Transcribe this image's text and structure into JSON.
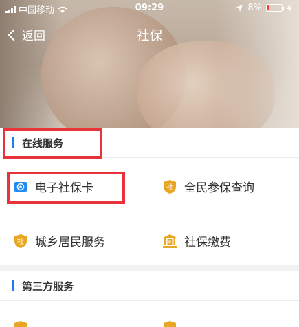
{
  "status_bar": {
    "carrier": "中国移动",
    "time": "09:29",
    "battery": "8%",
    "battery_level": 0.08
  },
  "nav": {
    "back_label": "返回",
    "title": "社保"
  },
  "sections": [
    {
      "title": "在线服务",
      "items": [
        {
          "label": "电子社保卡",
          "icon": "card-icon"
        },
        {
          "label": "全民参保查询",
          "icon": "shield-icon"
        },
        {
          "label": "城乡居民服务",
          "icon": "shield-icon"
        },
        {
          "label": "社保缴费",
          "icon": "bank-icon"
        }
      ]
    },
    {
      "title": "第三方服务"
    }
  ],
  "icon_badge_text": "社",
  "colors": {
    "accent_blue": "#1e7bf0",
    "icon_gold": "#e8a623",
    "highlight_red": "#e8333a"
  }
}
